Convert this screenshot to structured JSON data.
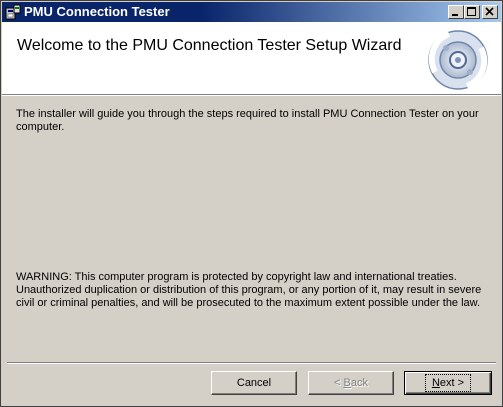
{
  "window": {
    "title": "PMU Connection Tester",
    "controls": [
      "minimize-icon",
      "maximize-icon",
      "close-icon"
    ]
  },
  "banner": {
    "title": "Welcome to the PMU Connection Tester Setup Wizard",
    "logo_icon": "setup-disc-icon"
  },
  "body": {
    "intro": "The installer will guide you through the steps required to install PMU Connection Tester on your computer.",
    "warning": "WARNING: This computer program is protected by copyright law and international treaties. Unauthorized duplication or distribution of this program, or any portion of it, may result in severe civil or criminal penalties, and will be prosecuted to the maximum extent possible under the law."
  },
  "buttons": {
    "cancel": "Cancel",
    "back_mnemonic": "< ",
    "back_underlined": "B",
    "back_rest": "ack",
    "next_underlined": "N",
    "next_rest": "ext >"
  },
  "colors": {
    "titlebar": "#0a246a",
    "face": "#d4d0c8",
    "disabled_text": "#808080"
  }
}
